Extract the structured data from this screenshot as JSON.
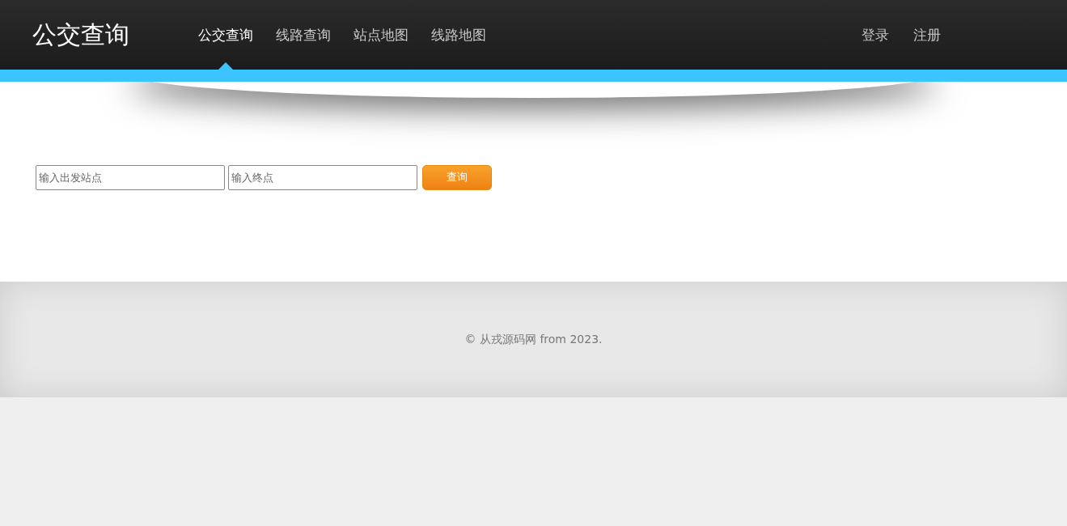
{
  "header": {
    "logo": "公交查询",
    "nav": [
      {
        "label": "公交查询",
        "selected": true
      },
      {
        "label": "线路查询",
        "selected": false
      },
      {
        "label": "站点地图",
        "selected": false
      },
      {
        "label": "线路地图",
        "selected": false
      }
    ],
    "user_links": [
      "登录",
      "注册"
    ]
  },
  "search": {
    "start": {
      "placeholder": "输入出发站点"
    },
    "end": {
      "placeholder": "输入终点"
    },
    "button": "查询"
  },
  "footer": {
    "copyright": "© 从戎源码网 from 2023."
  }
}
